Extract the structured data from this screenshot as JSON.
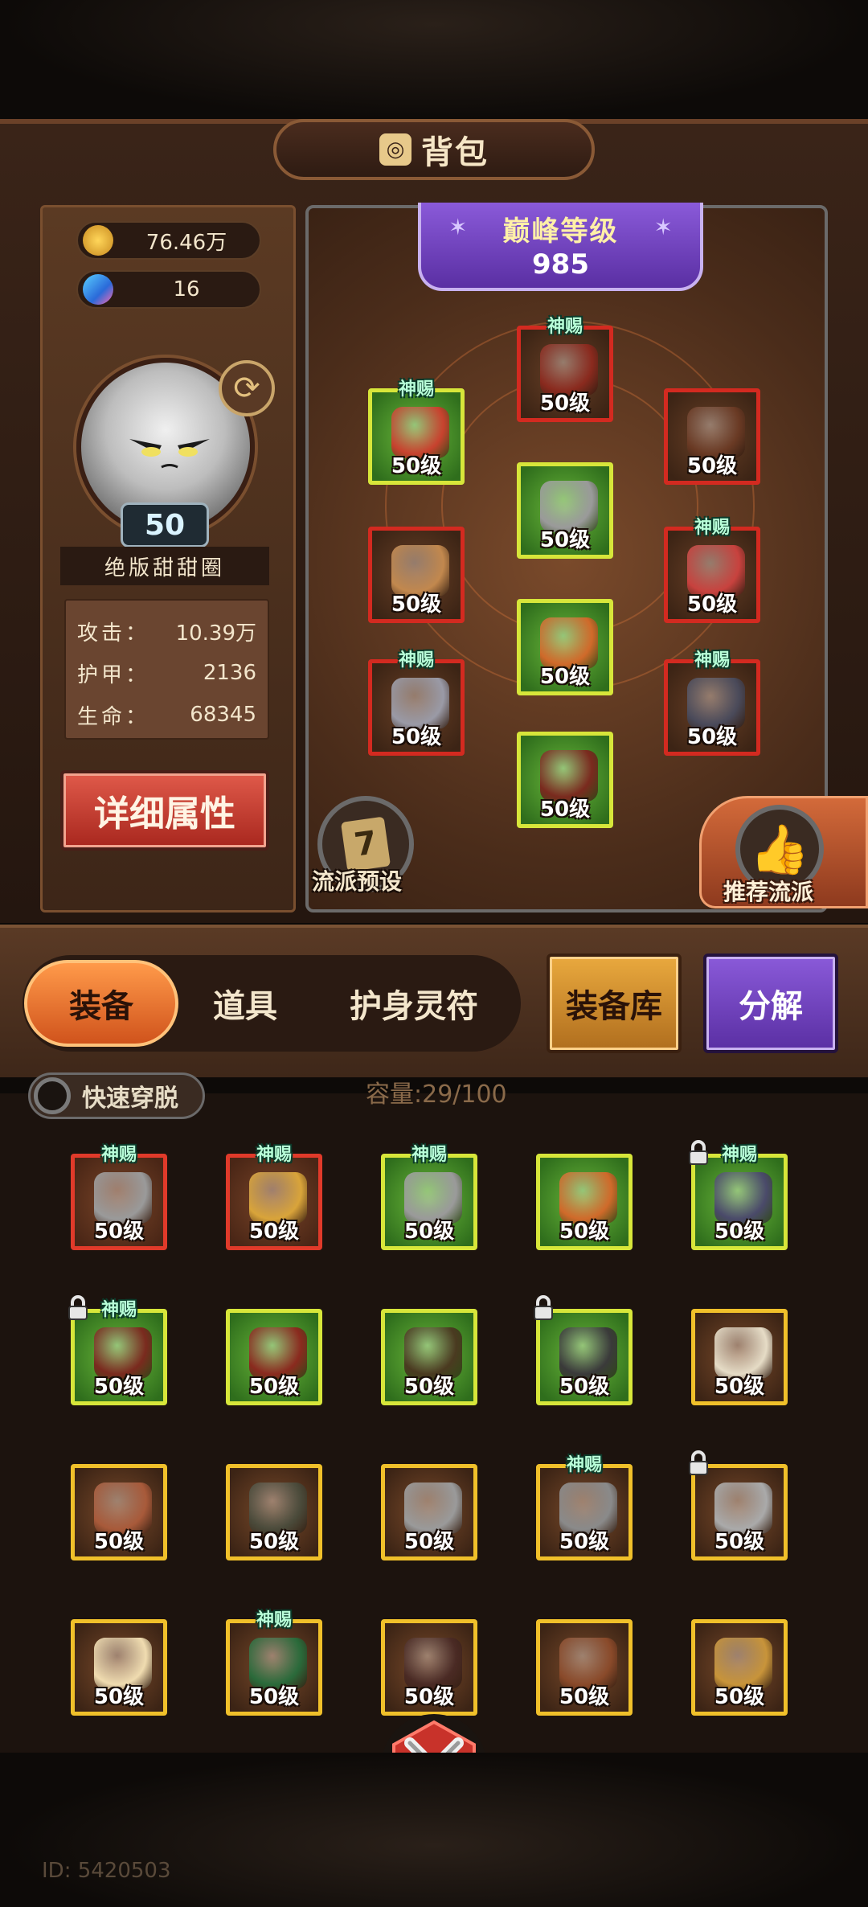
{
  "header": {
    "title": "背包"
  },
  "currency": [
    {
      "icon": "gold-coin-icon",
      "value": "76.46万"
    },
    {
      "icon": "diamond-icon",
      "value": "16"
    }
  ],
  "player": {
    "level": "50",
    "name": "绝版甜甜圈"
  },
  "stats": [
    {
      "label": "攻击：",
      "value": "10.39万"
    },
    {
      "label": "护甲：",
      "value": "2136"
    },
    {
      "label": "生命：",
      "value": "68345"
    }
  ],
  "detail_button": "详细属性",
  "peak": {
    "title": "巅峰等级",
    "value": "985"
  },
  "equipped": [
    {
      "name": "helmet",
      "label": "50级",
      "tag": "神赐",
      "quality": "red",
      "color": "#8a2a1e"
    },
    {
      "name": "shoulder",
      "label": "50级",
      "tag": "神赐",
      "quality": "red",
      "color": "#c8422e"
    },
    {
      "name": "necklace",
      "label": "50级",
      "tag": "",
      "quality": "red",
      "color": "#6a3a24"
    },
    {
      "name": "armor",
      "label": "50级",
      "tag": "",
      "quality": "green",
      "color": "#9a9a9a"
    },
    {
      "name": "glove",
      "label": "50级",
      "tag": "",
      "quality": "red",
      "color": "#c2884e"
    },
    {
      "name": "ring",
      "label": "50级",
      "tag": "神赐",
      "quality": "red",
      "color": "#c8423e"
    },
    {
      "name": "belt",
      "label": "50级",
      "tag": "",
      "quality": "green",
      "color": "#d06a2a"
    },
    {
      "name": "bracer",
      "label": "50级",
      "tag": "神赐",
      "quality": "red",
      "color": "#9a9aa6"
    },
    {
      "name": "amulet",
      "label": "50级",
      "tag": "神赐",
      "quality": "red",
      "color": "#4a4a5a"
    },
    {
      "name": "boots",
      "label": "50级",
      "tag": "",
      "quality": "green",
      "color": "#7a2a1e"
    }
  ],
  "school_preset": {
    "label": "流派预设",
    "badge": "7"
  },
  "recommend": {
    "label": "推荐流派"
  },
  "tabs": [
    {
      "label": "装备",
      "active": true
    },
    {
      "label": "道具",
      "active": false
    },
    {
      "label": "护身灵符",
      "active": false
    }
  ],
  "library_button": "装备库",
  "split_button": "分解",
  "quick_toggle": "快速穿脱",
  "capacity": "容量:29/100",
  "inventory": [
    {
      "label": "50级",
      "tag": "神赐",
      "quality": "red",
      "locked": false,
      "color": "#9a9a9a"
    },
    {
      "label": "50级",
      "tag": "神赐",
      "quality": "red",
      "locked": false,
      "color": "#d9a43a"
    },
    {
      "label": "50级",
      "tag": "神赐",
      "quality": "green",
      "locked": false,
      "color": "#9a9a9a"
    },
    {
      "label": "50级",
      "tag": "",
      "quality": "green",
      "locked": false,
      "color": "#d06a2a"
    },
    {
      "label": "50级",
      "tag": "神赐",
      "quality": "green",
      "locked": true,
      "color": "#4a4a6a"
    },
    {
      "label": "50级",
      "tag": "神赐",
      "quality": "green",
      "locked": true,
      "color": "#7a2a1e"
    },
    {
      "label": "50级",
      "tag": "",
      "quality": "green",
      "locked": false,
      "color": "#8a2a1e"
    },
    {
      "label": "50级",
      "tag": "",
      "quality": "green",
      "locked": false,
      "color": "#4a3a20"
    },
    {
      "label": "50级",
      "tag": "",
      "quality": "green",
      "locked": true,
      "color": "#3a3a3a"
    },
    {
      "label": "50级",
      "tag": "",
      "quality": "yellow",
      "locked": false,
      "color": "#e6dcc6"
    },
    {
      "label": "50级",
      "tag": "",
      "quality": "yellow",
      "locked": false,
      "color": "#a85a3a"
    },
    {
      "label": "50级",
      "tag": "",
      "quality": "yellow",
      "locked": false,
      "color": "#4a4a3a"
    },
    {
      "label": "50级",
      "tag": "",
      "quality": "yellow",
      "locked": false,
      "color": "#9a9a9a"
    },
    {
      "label": "50级",
      "tag": "神赐",
      "quality": "yellow",
      "locked": false,
      "color": "#8a8a8a"
    },
    {
      "label": "50级",
      "tag": "",
      "quality": "yellow",
      "locked": true,
      "color": "#aaaaaa"
    },
    {
      "label": "50级",
      "tag": "",
      "quality": "yellow",
      "locked": false,
      "color": "#f0dcb0"
    },
    {
      "label": "50级",
      "tag": "神赐",
      "quality": "yellow",
      "locked": false,
      "color": "#2a6a3a"
    },
    {
      "label": "50级",
      "tag": "",
      "quality": "yellow",
      "locked": false,
      "color": "#4a2a24"
    },
    {
      "label": "50级",
      "tag": "",
      "quality": "yellow",
      "locked": false,
      "color": "#8a4a2a"
    },
    {
      "label": "50级",
      "tag": "",
      "quality": "yellow",
      "locked": false,
      "color": "#c8943a"
    }
  ],
  "footer": {
    "id": "ID: 5420503"
  }
}
